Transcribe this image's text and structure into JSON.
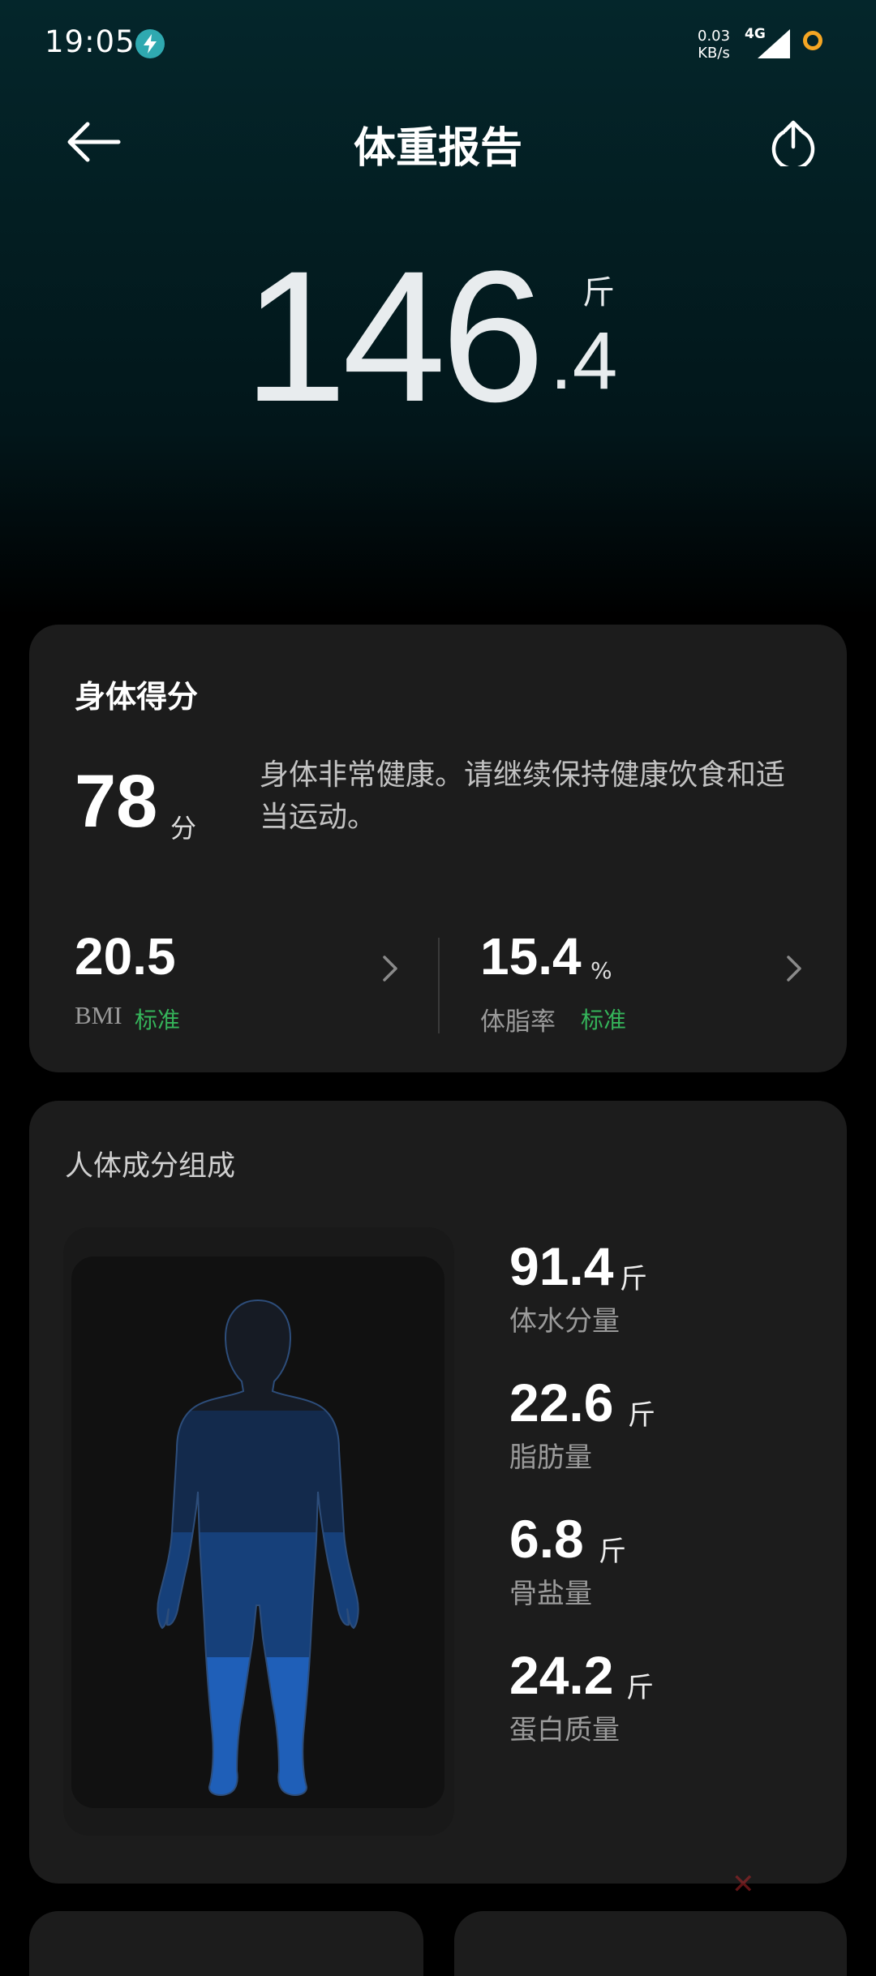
{
  "status_bar": {
    "time": "19:05",
    "net_speed_value": "0.03",
    "net_speed_unit": "KB/s",
    "network_type": "4G",
    "icons": [
      "charging-bolt-icon",
      "signal-icon",
      "battery-ring-icon"
    ]
  },
  "header": {
    "title": "体重报告",
    "back_icon": "arrow-left-icon",
    "share_icon": "share-upload-icon"
  },
  "weight": {
    "integer": "146",
    "decimal": ".4",
    "unit": "斤"
  },
  "body_score": {
    "title": "身体得分",
    "score": "78",
    "score_unit": "分",
    "description": "身体非常健康。请继续保持健康饮食和适当运动。",
    "bmi": {
      "value": "20.5",
      "label": "BMI",
      "status": "标准"
    },
    "body_fat": {
      "value": "15.4",
      "unit": "%",
      "label": "体脂率",
      "status": "标准"
    }
  },
  "composition": {
    "title": "人体成分组成",
    "items": [
      {
        "value": "91.4",
        "unit": "斤",
        "label": "体水分量"
      },
      {
        "value": "22.6",
        "unit": "斤",
        "label": "脂肪量"
      },
      {
        "value": "6.8",
        "unit": "斤",
        "label": "骨盐量"
      },
      {
        "value": "24.2",
        "unit": "斤",
        "label": "蛋白质量"
      }
    ]
  },
  "colors": {
    "status_green": "#35b45a",
    "card_bg": "#1c1c1c",
    "figure_blue": "#1f5fb8",
    "battery_orange": "#f5a623"
  }
}
